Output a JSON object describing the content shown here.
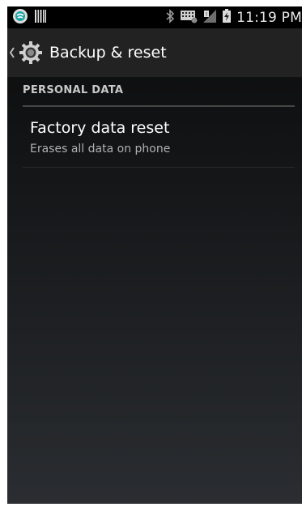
{
  "status_bar": {
    "time": "11:19 PM",
    "icons": [
      "app-notification-icon",
      "barcode-icon",
      "bluetooth-icon",
      "keyboard-icon",
      "no-signal-icon",
      "battery-charging-icon"
    ]
  },
  "action_bar": {
    "title": "Backup & reset",
    "icon": "settings-gear-icon",
    "up_icon": "chevron-left-icon"
  },
  "section": {
    "header": "PERSONAL DATA"
  },
  "items": [
    {
      "title": "Factory data reset",
      "summary": "Erases all data on phone"
    }
  ]
}
